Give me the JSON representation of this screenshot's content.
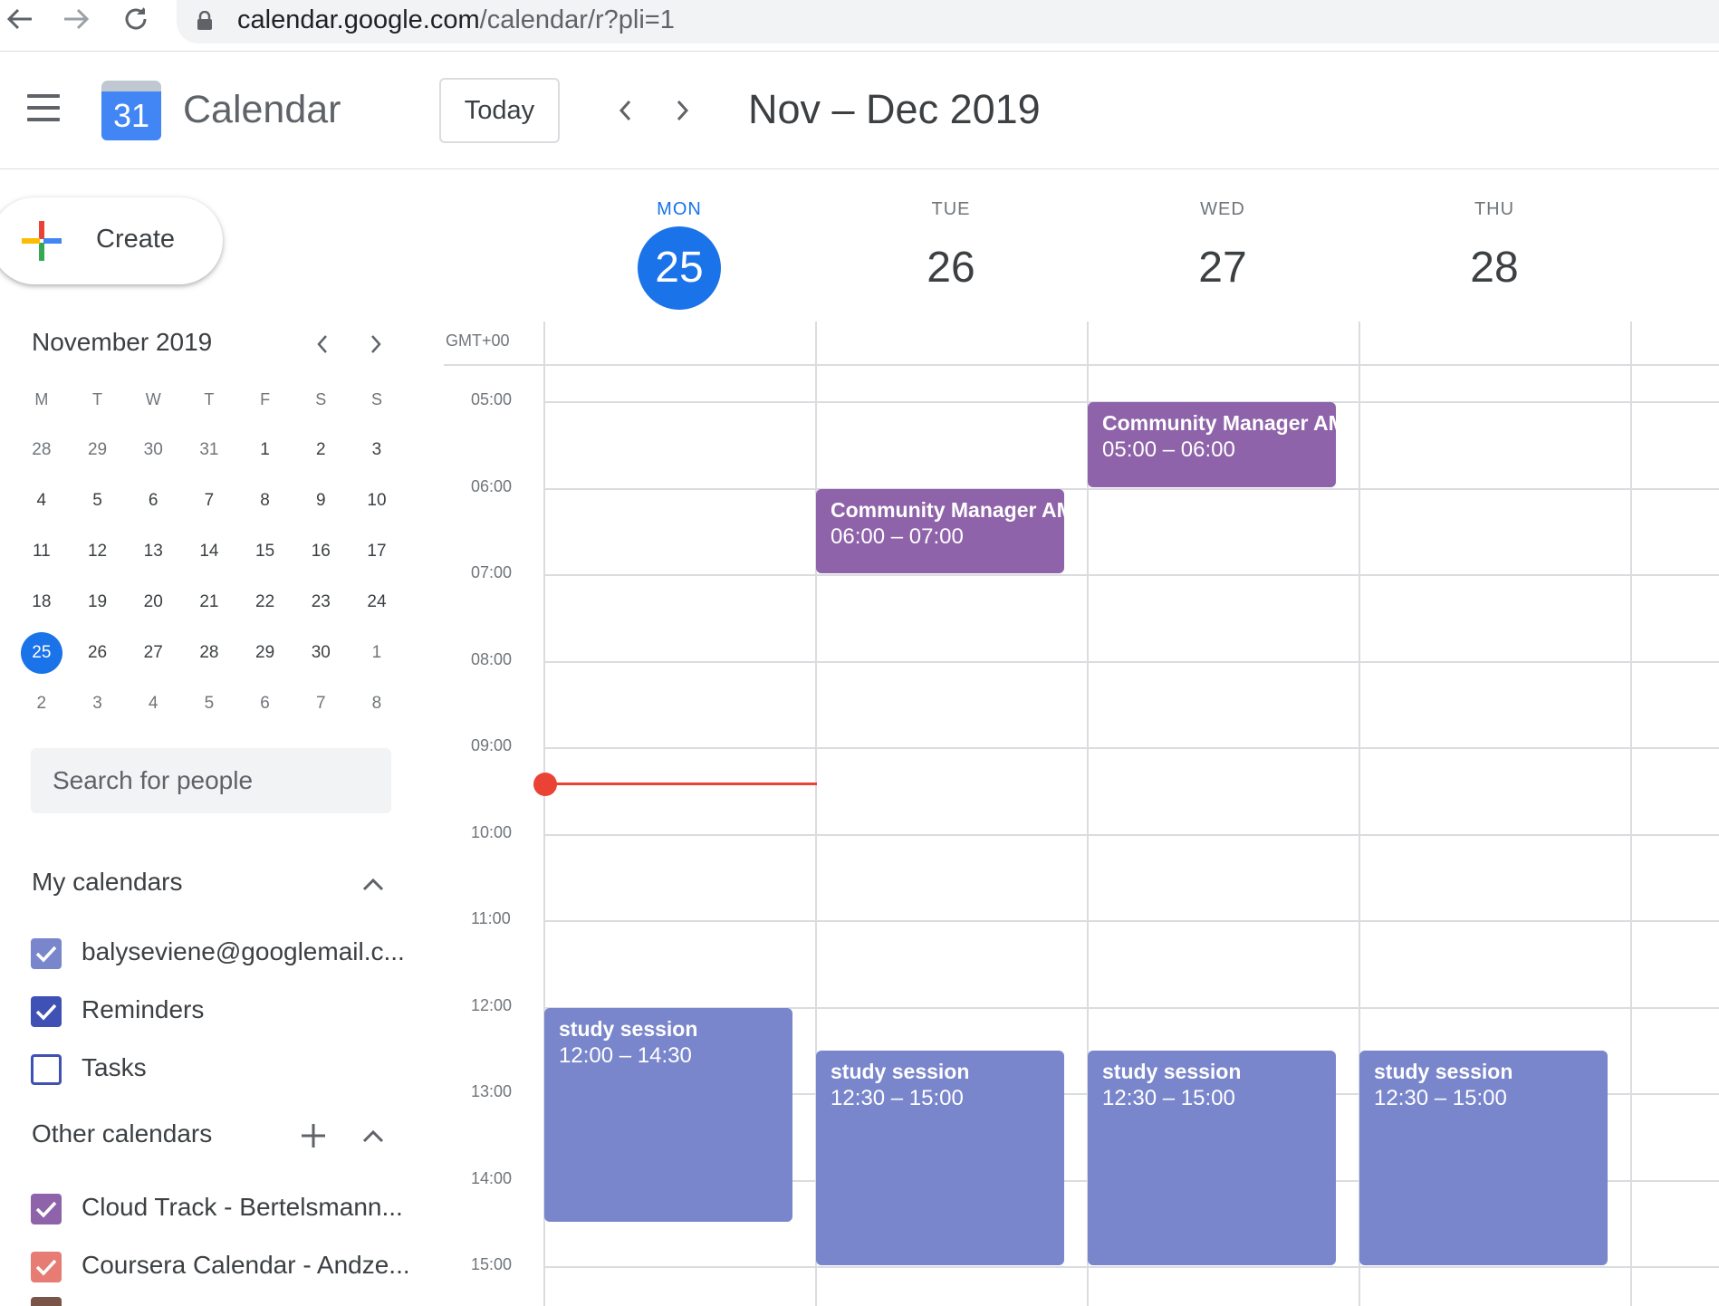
{
  "browser": {
    "url_host": "calendar.google.com",
    "url_path": "/calendar/r?pli=1"
  },
  "header": {
    "app_name": "Calendar",
    "logo_day": "31",
    "today_label": "Today",
    "date_range": "Nov – Dec 2019"
  },
  "sidebar": {
    "create_label": "Create",
    "mini_calendar": {
      "title": "November 2019",
      "weekdays": [
        "M",
        "T",
        "W",
        "T",
        "F",
        "S",
        "S"
      ],
      "weeks": [
        [
          "28",
          "29",
          "30",
          "31",
          "1",
          "2",
          "3"
        ],
        [
          "4",
          "5",
          "6",
          "7",
          "8",
          "9",
          "10"
        ],
        [
          "11",
          "12",
          "13",
          "14",
          "15",
          "16",
          "17"
        ],
        [
          "18",
          "19",
          "20",
          "21",
          "22",
          "23",
          "24"
        ],
        [
          "25",
          "26",
          "27",
          "28",
          "29",
          "30",
          "1"
        ],
        [
          "2",
          "3",
          "4",
          "5",
          "6",
          "7",
          "8"
        ]
      ]
    },
    "search_placeholder": "Search for people",
    "my_calendars": {
      "title": "My calendars",
      "items": [
        {
          "label": "balyseviene@googlemail.c...",
          "color": "#7986cb",
          "checked": true
        },
        {
          "label": "Reminders",
          "color": "#3f51b5",
          "checked": true
        },
        {
          "label": "Tasks",
          "color": "#3f51b5",
          "checked": false
        }
      ]
    },
    "other_calendars": {
      "title": "Other calendars",
      "items": [
        {
          "label": "Cloud Track - Bertelsmann...",
          "color": "#8e63a9",
          "checked": true
        },
        {
          "label": "Coursera Calendar - Andze...",
          "color": "#e67c73",
          "checked": true
        }
      ]
    }
  },
  "week": {
    "timezone": "GMT+00",
    "days": [
      {
        "dow": "MON",
        "num": "25",
        "today": true
      },
      {
        "dow": "TUE",
        "num": "26",
        "today": false
      },
      {
        "dow": "WED",
        "num": "27",
        "today": false
      },
      {
        "dow": "THU",
        "num": "28",
        "today": false
      }
    ],
    "hours": [
      "05:00",
      "06:00",
      "07:00",
      "08:00",
      "09:00",
      "10:00",
      "11:00",
      "12:00",
      "13:00",
      "14:00",
      "15:00"
    ],
    "events": [
      {
        "day": 2,
        "title": "Community Manager AM",
        "time": "05:00 – 06:00",
        "color": "#8e63a9"
      },
      {
        "day": 1,
        "title": "Community Manager AM",
        "time": "06:00 – 07:00",
        "color": "#8e63a9"
      },
      {
        "day": 0,
        "title": "study session",
        "time": "12:00 – 14:30",
        "color": "#7986cb"
      },
      {
        "day": 1,
        "title": "study session",
        "time": "12:30 – 15:00",
        "color": "#7986cb"
      },
      {
        "day": 2,
        "title": "study session",
        "time": "12:30 – 15:00",
        "color": "#7986cb"
      },
      {
        "day": 3,
        "title": "study session",
        "time": "12:30 – 15:00",
        "color": "#7986cb"
      }
    ],
    "current_time_day": 0
  }
}
